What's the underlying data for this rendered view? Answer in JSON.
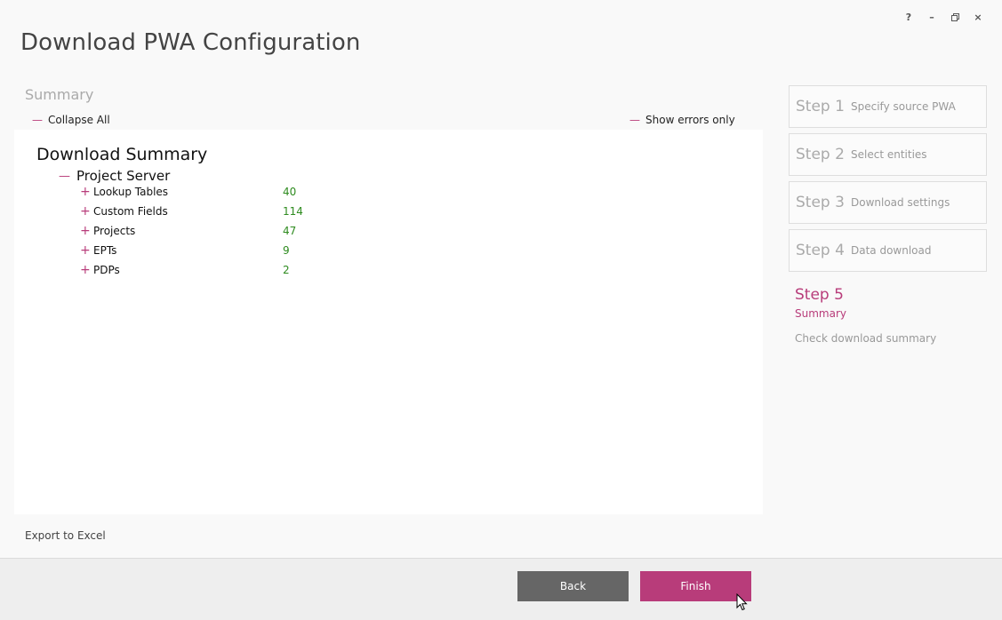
{
  "window": {
    "title": "Download PWA Configuration",
    "controls": {
      "help": "?",
      "minimize": "–",
      "restore": "restore",
      "close": "×"
    }
  },
  "summary_section": {
    "label": "Summary",
    "collapse_all": "Collapse All",
    "show_errors_only": "Show errors only",
    "download_summary_title": "Download Summary",
    "group": {
      "name": "Project Server",
      "items": [
        {
          "label": "Lookup Tables",
          "count": "40"
        },
        {
          "label": "Custom Fields",
          "count": "114"
        },
        {
          "label": "Projects",
          "count": "47"
        },
        {
          "label": "EPTs",
          "count": "9"
        },
        {
          "label": "PDPs",
          "count": "2"
        }
      ]
    },
    "export_to_excel": "Export to Excel"
  },
  "steps": [
    {
      "num": "Step 1",
      "name": "Specify source PWA"
    },
    {
      "num": "Step 2",
      "name": "Select entities"
    },
    {
      "num": "Step 3",
      "name": "Download settings"
    },
    {
      "num": "Step 4",
      "name": "Data download"
    }
  ],
  "active_step": {
    "num": "Step 5",
    "name": "Summary",
    "desc": "Check download summary"
  },
  "footer": {
    "back": "Back",
    "finish": "Finish"
  },
  "colors": {
    "accent": "#b83c7a",
    "count_green": "#2e8b1f",
    "back_button": "#666666"
  }
}
